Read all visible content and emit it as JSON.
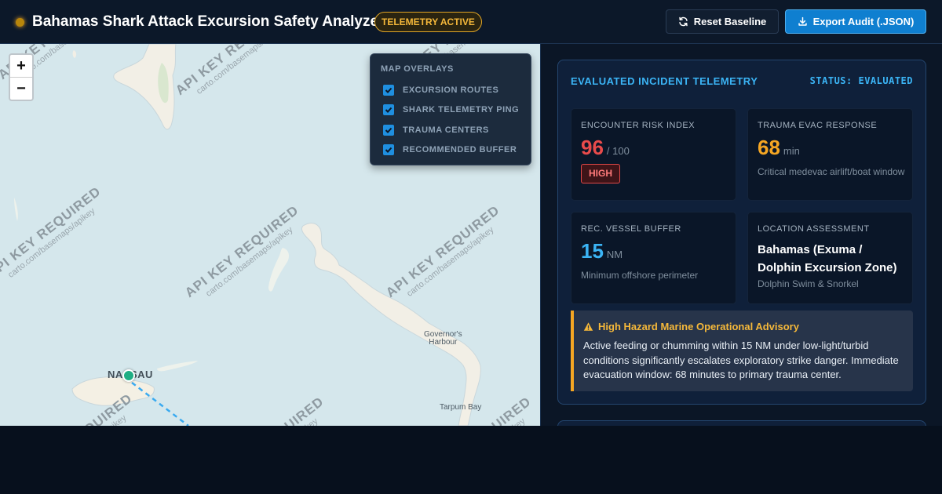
{
  "header": {
    "title": "Bahamas Shark Attack Excursion Safety Analyzer",
    "badge": "TELEMETRY ACTIVE",
    "reset_label": "Reset Baseline",
    "export_label": "Export Audit (.JSON)",
    "icons": {
      "reset": "refresh-icon",
      "export": "download-icon",
      "status": "status-dot-icon"
    },
    "colors": {
      "accent": "#3bb4f5",
      "badge": "#f5b83a",
      "export_button": "#0f7fd0"
    }
  },
  "map": {
    "zoom_in": "+",
    "zoom_out": "−",
    "watermark_text": "API KEY REQUIRED",
    "watermark_sub": "carto.com/basemaps/apikey",
    "place_nassau": "NASSAU",
    "place_governors_line1": "Governor's",
    "place_governors_line2": "Harbour",
    "place_tarpum": "Tarpum Bay",
    "overlays": {
      "title": "MAP OVERLAYS",
      "items": [
        {
          "label": "EXCURSION ROUTES",
          "checked": true
        },
        {
          "label": "SHARK TELEMETRY PING",
          "checked": true
        },
        {
          "label": "TRAUMA CENTERS",
          "checked": true
        },
        {
          "label": "RECOMMENDED BUFFER",
          "checked": true
        }
      ]
    }
  },
  "panel": {
    "title": "EVALUATED INCIDENT TELEMETRY",
    "status": "STATUS: EVALUATED",
    "risk": {
      "label": "ENCOUNTER RISK INDEX",
      "value": "96",
      "unit": "/ 100",
      "level": "HIGH",
      "color": "#e94b4b"
    },
    "evac": {
      "label": "TRAUMA EVAC RESPONSE",
      "value": "68",
      "unit": "min",
      "note": "Critical medevac airlift/boat window",
      "color": "#f5a623"
    },
    "buffer": {
      "label": "REC. VESSEL BUFFER",
      "value": "15",
      "unit": "NM",
      "note": "Minimum offshore perimeter",
      "color": "#3bb4f5"
    },
    "location": {
      "label": "LOCATION ASSESSMENT",
      "value": "Bahamas (Exuma / Dolphin Excursion Zone)",
      "note": "Dolphin Swim & Snorkel"
    },
    "advisory": {
      "title": "High Hazard Marine Operational Advisory",
      "body": "Active feeding or chumming within 15 NM under low-light/turbid conditions significantly escalates exploratory strike danger. Immediate evacuation window: 68 minutes to primary trauma center.",
      "icon": "warning-icon"
    }
  }
}
